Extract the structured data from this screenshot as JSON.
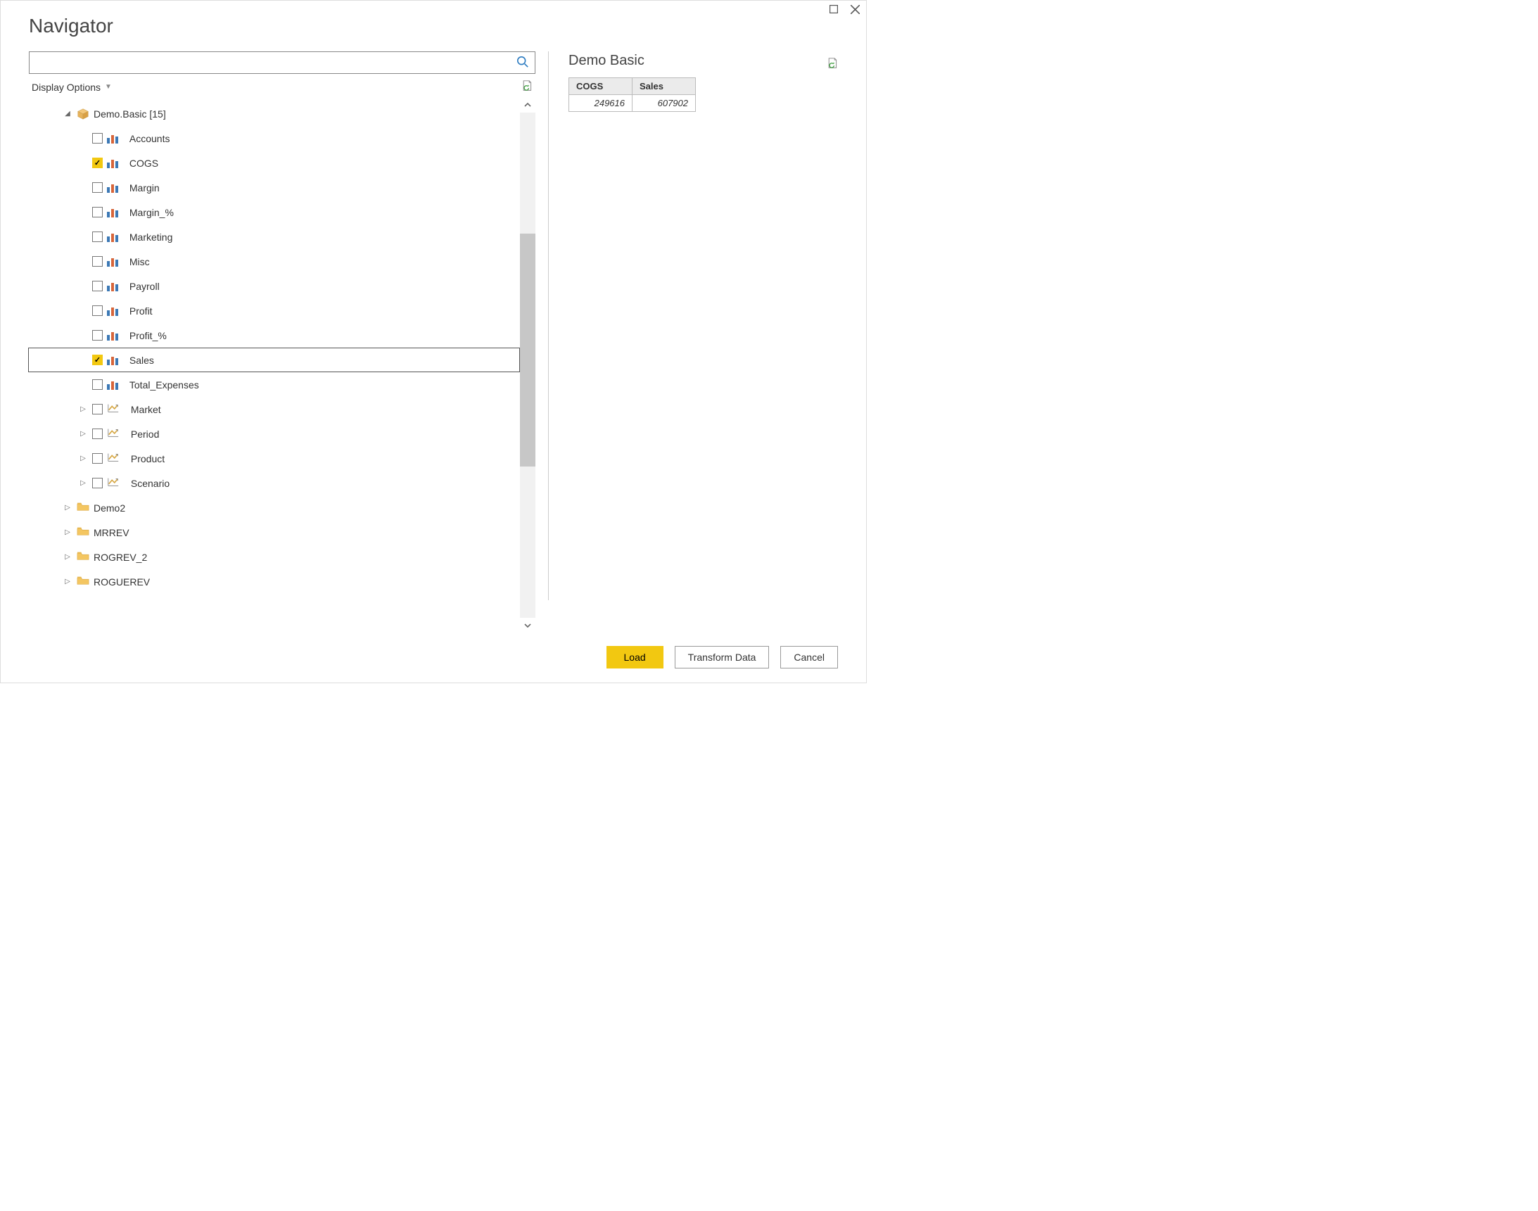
{
  "window": {
    "title": "Navigator",
    "displayOptionsLabel": "Display Options"
  },
  "search": {
    "placeholder": ""
  },
  "tree": {
    "rootLabel": "Demo.Basic [15]",
    "items": [
      {
        "label": "Accounts",
        "checked": false,
        "type": "measure"
      },
      {
        "label": "COGS",
        "checked": true,
        "type": "measure"
      },
      {
        "label": "Margin",
        "checked": false,
        "type": "measure"
      },
      {
        "label": "Margin_%",
        "checked": false,
        "type": "measure"
      },
      {
        "label": "Marketing",
        "checked": false,
        "type": "measure"
      },
      {
        "label": "Misc",
        "checked": false,
        "type": "measure"
      },
      {
        "label": "Payroll",
        "checked": false,
        "type": "measure"
      },
      {
        "label": "Profit",
        "checked": false,
        "type": "measure"
      },
      {
        "label": "Profit_%",
        "checked": false,
        "type": "measure"
      },
      {
        "label": "Sales",
        "checked": true,
        "type": "measure",
        "selected": true
      },
      {
        "label": "Total_Expenses",
        "checked": false,
        "type": "measure"
      },
      {
        "label": "Market",
        "checked": false,
        "type": "dimension",
        "expandable": true
      },
      {
        "label": "Period",
        "checked": false,
        "type": "dimension",
        "expandable": true
      },
      {
        "label": "Product",
        "checked": false,
        "type": "dimension",
        "expandable": true
      },
      {
        "label": "Scenario",
        "checked": false,
        "type": "dimension",
        "expandable": true
      }
    ],
    "siblings": [
      {
        "label": "Demo2"
      },
      {
        "label": "MRREV"
      },
      {
        "label": "ROGREV_2"
      },
      {
        "label": "ROGUEREV"
      }
    ]
  },
  "preview": {
    "title": "Demo Basic",
    "columns": [
      "COGS",
      "Sales"
    ],
    "rows": [
      [
        "249616",
        "607902"
      ]
    ]
  },
  "footer": {
    "loadLabel": "Load",
    "transformLabel": "Transform Data",
    "cancelLabel": "Cancel"
  }
}
